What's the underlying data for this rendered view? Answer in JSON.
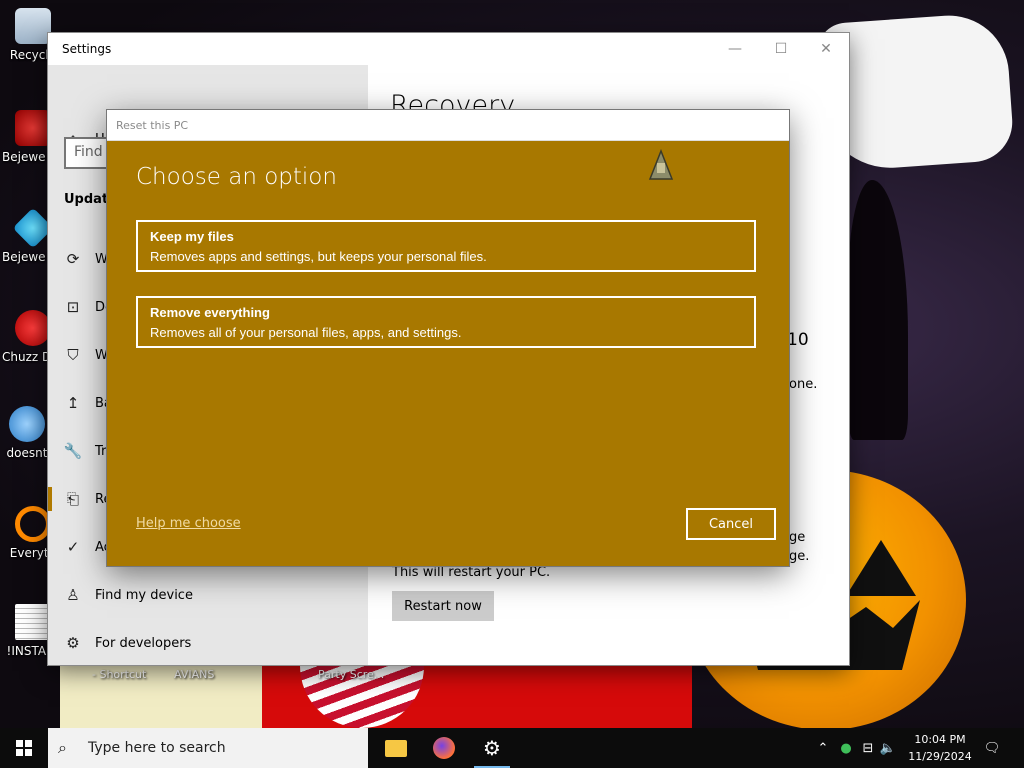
{
  "desktop": {
    "icons": [
      {
        "label": "Recycle",
        "icon": "recycle-bin-icon"
      },
      {
        "label": "Bejewe Delux",
        "icon": "bejeweled-icon"
      },
      {
        "label": "Bejewe Delux",
        "icon": "bejeweled-2-icon"
      },
      {
        "label": "Chuzz Delux",
        "icon": "chuzzle-icon"
      },
      {
        "label": "doesnt",
        "icon": "app-icon"
      },
      {
        "label": "Everyth",
        "icon": "everything-search-icon"
      },
      {
        "label": "!INSTALL",
        "icon": "document-icon"
      }
    ],
    "wallpaper_labels": {
      "shortcut": "- Shortcut",
      "avians": "AVIANS",
      "party": "Party Scre..."
    }
  },
  "settings": {
    "title": "Settings",
    "controls": {
      "minimize": "—",
      "maximize": "☐",
      "close": "✕"
    },
    "home": "Home",
    "search_placeholder": "Find",
    "section": "Update",
    "nav": [
      {
        "label": "W",
        "icon": "sync-icon"
      },
      {
        "label": "De",
        "icon": "delivery-optimization-icon"
      },
      {
        "label": "W",
        "icon": "shield-icon"
      },
      {
        "label": "Ba",
        "icon": "backup-icon"
      },
      {
        "label": "Tr",
        "icon": "troubleshoot-icon"
      },
      {
        "label": "Re",
        "icon": "recovery-icon",
        "active": true
      },
      {
        "label": "Ac",
        "icon": "activation-icon"
      },
      {
        "label": "Find my device",
        "icon": "find-my-device-icon"
      },
      {
        "label": "For developers",
        "icon": "developers-icon"
      }
    ],
    "page_title": "Recovery",
    "fragments": {
      "ten": "10",
      "one": "one.",
      "ge1": "ge",
      "ge2": "ge."
    },
    "restart_note": "This will restart your PC.",
    "restart_button": "Restart now"
  },
  "reset_dialog": {
    "window_title": "Reset this PC",
    "heading": "Choose an option",
    "options": [
      {
        "title": "Keep my files",
        "description": "Removes apps and settings, but keeps your personal files."
      },
      {
        "title": "Remove everything",
        "description": "Removes all of your personal files, apps, and settings."
      }
    ],
    "help_link": "Help me choose",
    "cancel": "Cancel"
  },
  "taskbar": {
    "search_placeholder": "Type here to search",
    "apps": [
      "file-explorer-icon",
      "firefox-icon",
      "settings-gear-icon"
    ],
    "time": "10:04 PM",
    "date": "11/29/2024"
  },
  "colors": {
    "accent": "#a87800",
    "accent_highlight": "#b07a00"
  }
}
